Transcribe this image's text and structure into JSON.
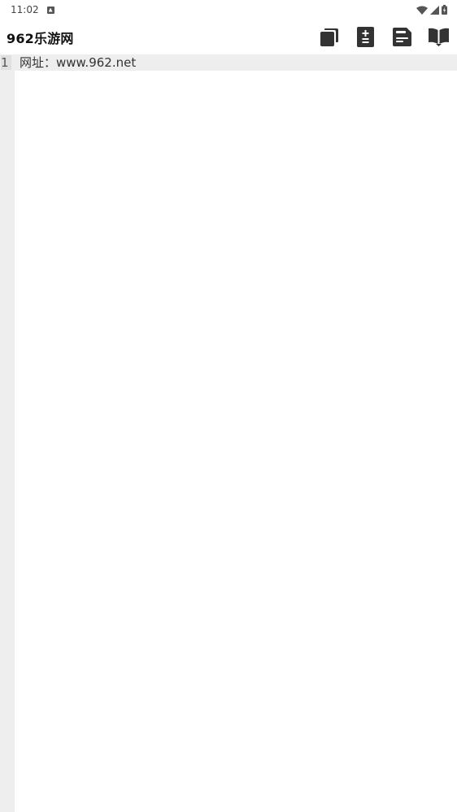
{
  "status_bar": {
    "time": "11:02",
    "notification_icon": "notification-a-icon",
    "wifi_icon": "wifi-icon",
    "signal_icon": "cell-signal-icon",
    "battery_icon": "battery-icon"
  },
  "app_bar": {
    "title": "962乐游网",
    "actions": [
      {
        "icon": "copy-icon"
      },
      {
        "icon": "file-diff-icon"
      },
      {
        "icon": "save-icon"
      },
      {
        "icon": "book-open-icon"
      }
    ]
  },
  "editor": {
    "lines": [
      {
        "number": "1",
        "text": "网址：www.962.net"
      }
    ]
  },
  "colors": {
    "gutter": "#eeeeee",
    "icon": "#333333",
    "text": "#333333"
  }
}
